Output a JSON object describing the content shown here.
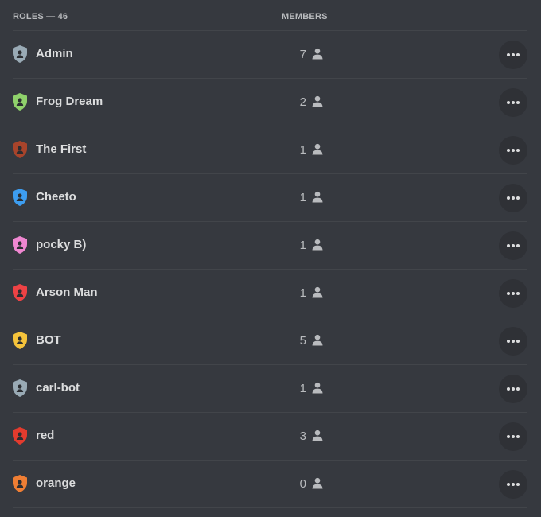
{
  "header": {
    "roles_count": "ROLES — 46",
    "members_column": "MEMBERS"
  },
  "roles": [
    {
      "name": "Admin",
      "members": "7",
      "color": "#99aab5"
    },
    {
      "name": "Frog Dream",
      "members": "2",
      "color": "#8fd16b"
    },
    {
      "name": "The First",
      "members": "1",
      "color": "#a8442b"
    },
    {
      "name": "Cheeto",
      "members": "1",
      "color": "#3d9df0"
    },
    {
      "name": "pocky B)",
      "members": "1",
      "color": "#ef87d1"
    },
    {
      "name": "Arson Man",
      "members": "1",
      "color": "#ed4245"
    },
    {
      "name": "BOT",
      "members": "5",
      "color": "#f5c33b"
    },
    {
      "name": "carl-bot",
      "members": "1",
      "color": "#99aab5"
    },
    {
      "name": "red",
      "members": "3",
      "color": "#e33b2e"
    },
    {
      "name": "orange",
      "members": "0",
      "color": "#ef7e34"
    }
  ],
  "icons": {
    "role": "shield-icon",
    "member": "person-icon",
    "more": "more-options-icon"
  }
}
